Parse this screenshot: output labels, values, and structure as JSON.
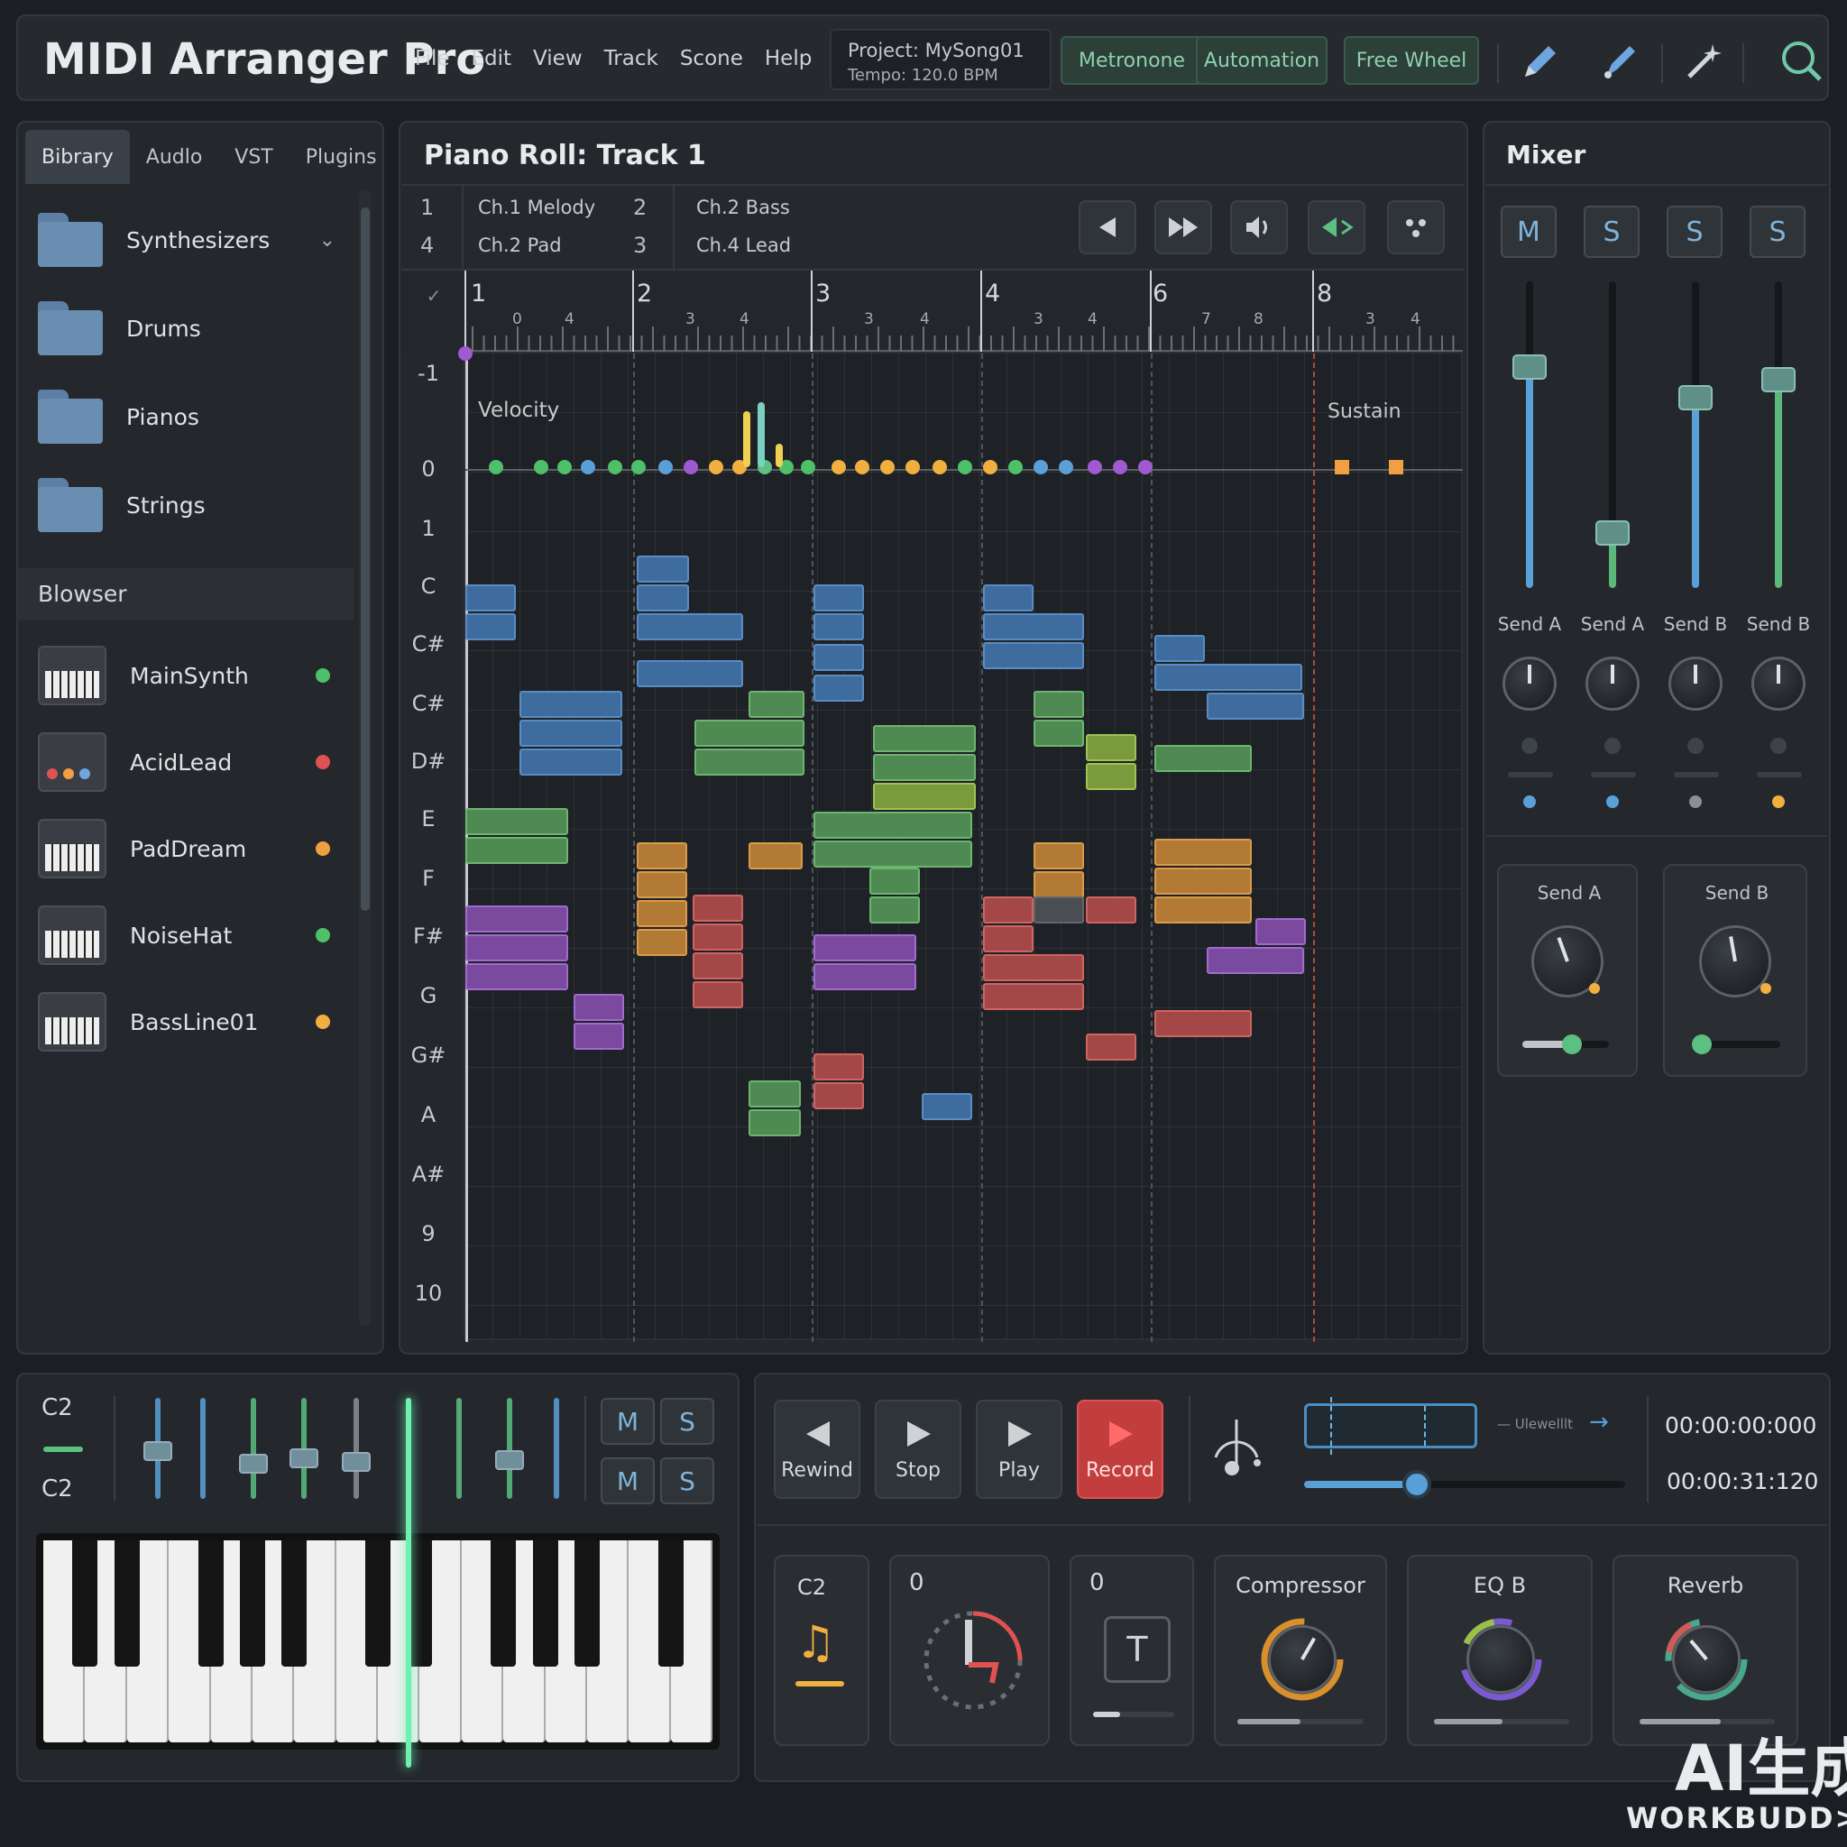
{
  "app": {
    "title": "MIDI Arranger Pro"
  },
  "menu": [
    "File",
    "Edit",
    "View",
    "Track",
    "Scone",
    "Help"
  ],
  "project": {
    "name": "Project: MySong01",
    "tempo": "Tempo: 120.0 BPM"
  },
  "toolbar": {
    "metronome": "Metronone",
    "automation": "Automation",
    "free_wheel": "Free Wheel",
    "icons": [
      "pencil-icon",
      "brush-icon",
      "magic-wand-icon",
      "search-icon"
    ]
  },
  "left_panel": {
    "tabs": [
      "Bibrary",
      "Audlo",
      "VST",
      "Plugins"
    ],
    "folders": [
      "Synthesizers",
      "Drums",
      "Pianos",
      "Strings"
    ],
    "browser_title": "Blowser",
    "plugins": [
      {
        "name": "MainSynth",
        "color": "#4fc06a"
      },
      {
        "name": "AcidLead",
        "color": "#e05252"
      },
      {
        "name": "PadDream",
        "color": "#f0a040"
      },
      {
        "name": "NoiseHat",
        "color": "#4fc06a"
      },
      {
        "name": "BassLine01",
        "color": "#f0b040"
      }
    ]
  },
  "piano_roll": {
    "title": "Piano Roll: Track 1",
    "channels": [
      {
        "num": "1",
        "label": "Ch.1 Melody"
      },
      {
        "num": "2",
        "label": "Ch.2 Bass"
      },
      {
        "num": "4",
        "label": "Ch.2 Pad"
      },
      {
        "num": "3",
        "label": "Ch.4 Lead"
      }
    ],
    "ruler": {
      "bars": [
        "1",
        "2",
        "3",
        "4",
        "6",
        "8"
      ],
      "subs": [
        [
          "0",
          "4"
        ],
        [
          "3",
          "4"
        ],
        [
          "3",
          "4"
        ],
        [
          "3",
          "4"
        ],
        [
          "7",
          "8"
        ],
        [
          "3",
          "4"
        ]
      ]
    },
    "pitch_labels": [
      "-1",
      "0",
      "1",
      "C",
      "C#",
      "C#",
      "D#",
      "E",
      "F",
      "F#",
      "G",
      "G#",
      "A",
      "A#",
      "9",
      "10"
    ],
    "velocity_label": "Velocity",
    "sustain_label": "Sustain"
  },
  "mixer": {
    "title": "Mixer",
    "buttons": [
      "M",
      "S",
      "S",
      "S"
    ],
    "channels": [
      {
        "label": "Send A",
        "level": 0.72,
        "color": "#5aa0d8"
      },
      {
        "label": "Send A",
        "level": 0.18,
        "color": "#5cb87a"
      },
      {
        "label": "Send B",
        "level": 0.62,
        "color": "#5aa0d8"
      },
      {
        "label": "Send B",
        "level": 0.68,
        "color": "#5cb87a"
      }
    ],
    "sends": [
      {
        "label": "Send A"
      },
      {
        "label": "Send B"
      }
    ]
  },
  "keyboard": {
    "note_top": "C2",
    "note_bottom": "C2",
    "buttons": [
      "M",
      "S",
      "M",
      "S"
    ]
  },
  "transport": {
    "rewind": "Rewind",
    "stop": "Stop",
    "play": "Play",
    "record": "Record",
    "loop_label": "— Ulewelllt",
    "time_1": "00:00:00:000",
    "time_2": "00:00:31:120",
    "position": 0.35
  },
  "fx": {
    "note_label": "C2",
    "dial_1": "0",
    "dial_2": "0",
    "compressor": "Compressor",
    "eq": "EQ B",
    "reverb": "Reverb"
  },
  "watermark": {
    "line1": "AI生成",
    "line2": "WORKBUDD>."
  },
  "colors": {
    "accent": "#8fd0b0",
    "record": "#e04a4a"
  }
}
